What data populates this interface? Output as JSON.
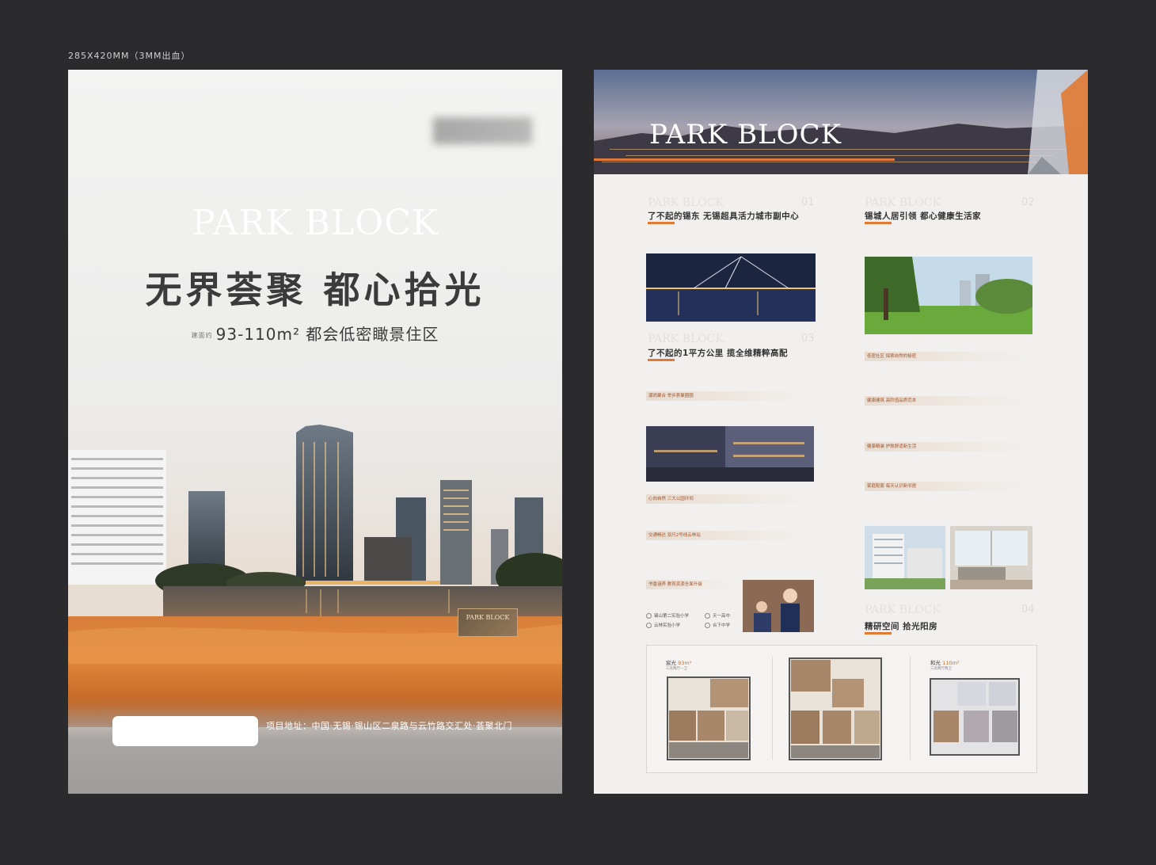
{
  "spec": "285X420MM（3MM出血）",
  "front": {
    "title_en": "PARK BLOCK",
    "headline": "无界荟聚  都心拾光",
    "sub_unit": "建面约",
    "sub_area": "93-110m²",
    "sub_desc": "都会低密瞰景住区",
    "address": "项目地址：中国·无锡·锡山区二泉路与云竹路交汇处·荟聚北门",
    "badge_en": "PARK BLOCK"
  },
  "back": {
    "banner_title": "PARK BLOCK",
    "sections": [
      {
        "en": "PARK BLOCK",
        "num": "01",
        "title": "了不起的锡东  无锡超具活力城市副中心"
      },
      {
        "en": "PARK BLOCK",
        "num": "02",
        "title": "锡城人居引领  都心健康生活家"
      },
      {
        "en": "PARK BLOCK",
        "num": "03",
        "title": "了不起的1平方公里  揽全维精粹高配"
      },
      {
        "en": "PARK BLOCK",
        "num": "04",
        "title": "精研空间  拾光阳房"
      }
    ],
    "left_tags": [
      "潮尚聚合  举步荟聚圈圈",
      "心向自然  三大公园环伺",
      "交通畅达  双尺2号线云林站",
      "书香涵养  教育资源全面升级"
    ],
    "right_tags": [
      "低密社区  探索自然的秘密",
      "健康建筑  高阶值品质范本",
      "健康精装  护航舒适新生活",
      "家庭配套  每天认识新邻居"
    ],
    "schools": [
      "锡山第二实验小学",
      "天一高中",
      "云林实验小学",
      "合下中学"
    ],
    "plans": [
      {
        "name": "宸光",
        "area": "93",
        "unit": "m²",
        "desc": "三房两厅一卫"
      },
      {
        "name": "沐光",
        "area": "104",
        "unit": "m²",
        "desc": "三房两厅两卫"
      },
      {
        "name": "和光",
        "area": "110",
        "unit": "m²",
        "desc": "三房两厅两卫"
      }
    ]
  }
}
